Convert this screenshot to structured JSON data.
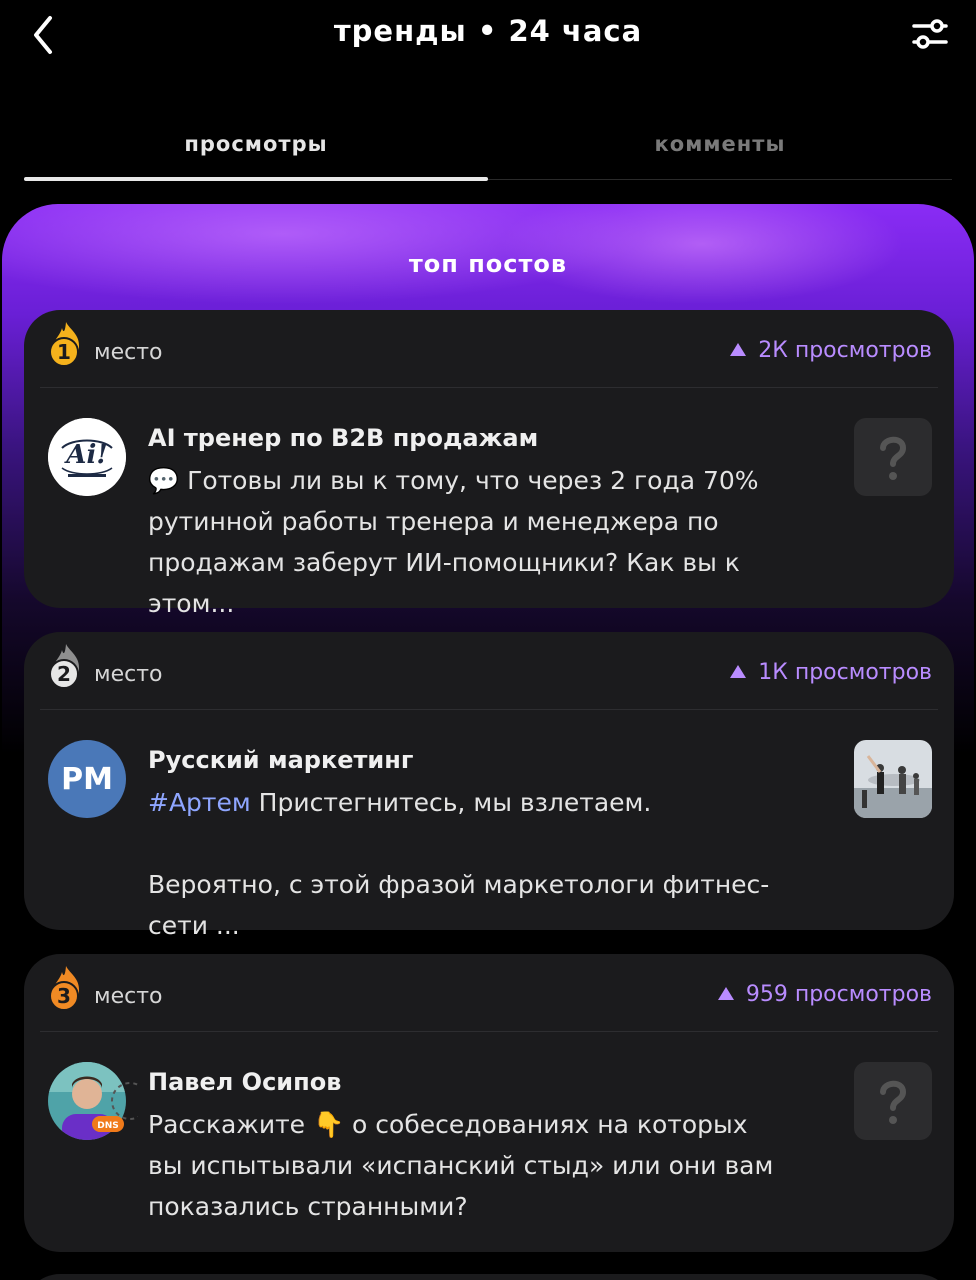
{
  "header": {
    "title": "тренды • 24 часа",
    "back_icon": "chevron-left-icon",
    "filter_icon": "sliders-icon"
  },
  "tabs": [
    {
      "label": "просмотры",
      "active": true
    },
    {
      "label": "комменты",
      "active": false
    }
  ],
  "panel": {
    "title": "топ постов"
  },
  "posts": [
    {
      "rank": "1",
      "rank_color": "#f5b21c",
      "place_label": "место",
      "views": "2К просмотров",
      "author": "AI тренер по B2B продажам",
      "text": "💬 Готовы ли вы к тому, что через 2 года 70% рутинной работы тренера и менеджера по продажам заберут ИИ-помощники? Как вы к этом...",
      "thumb": "question-mark"
    },
    {
      "rank": "2",
      "rank_color": "#9a9a9a",
      "place_label": "место",
      "views": "1К просмотров",
      "author": "Русский маркетинг",
      "avatar_text": "PM",
      "hashtag": "#Артем",
      "text": " Пристегнитесь, мы взлетаем.\n\nВероятно, с этой фразой маркетологи фитнес-сети ...",
      "thumb": "photo"
    },
    {
      "rank": "3",
      "rank_color": "#f08a24",
      "place_label": "место",
      "views": "959 просмотров",
      "author": "Павел Осипов",
      "avatar_badge": "DNS",
      "text": "Расскажите 👇 о собеседованиях на которых вы испытывали «испанский стыд» или они вам показались странными?",
      "thumb": "question-mark"
    }
  ],
  "colors": {
    "accent": "#b98cff",
    "panel_gradient_top": "#8a2cf5",
    "card_bg": "#1b1b1d"
  }
}
